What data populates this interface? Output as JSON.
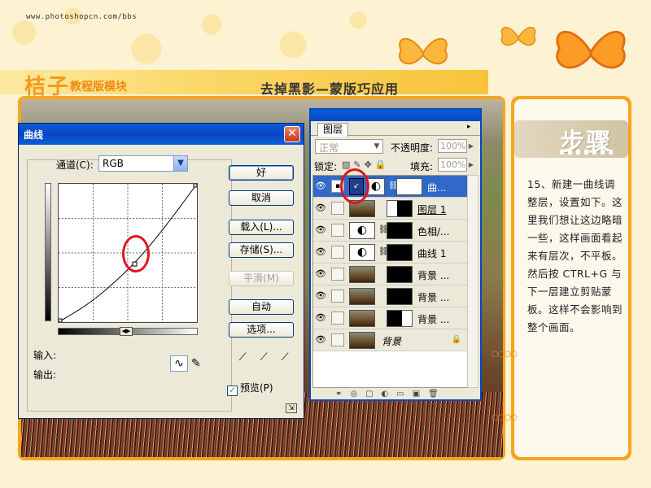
{
  "site_url": "www.photoshopcn.com/bbs",
  "brand": "桔子",
  "brand_sub": "教程版模块",
  "lesson_title": "去掉黑影—蒙版巧应用",
  "colors": {
    "accent": "#f8a420",
    "xp_blue": "#0a5fd8",
    "highlight_red": "#e1141e"
  },
  "curves_dialog": {
    "title": "曲线",
    "channel_label": "通道(C):",
    "channel_value": "RGB",
    "input_label": "输入:",
    "output_label": "输出:",
    "buttons": {
      "ok": "好",
      "cancel": "取消",
      "load": "载入(L)...",
      "save": "存储(S)...",
      "smooth": "平滑(M)",
      "auto": "自动",
      "options": "选项..."
    },
    "preview_label": "预览(P)",
    "preview_checked": true,
    "curve_points": [
      [
        0,
        0
      ],
      [
        0.25,
        0.15
      ],
      [
        0.55,
        0.42
      ],
      [
        0.78,
        0.7
      ],
      [
        1,
        1
      ]
    ],
    "control_point": [
      0.55,
      0.42
    ]
  },
  "layers_panel": {
    "tab": "图层",
    "blend_mode": "正常",
    "opacity_label": "不透明度:",
    "opacity_value": "100%",
    "lock_label": "锁定:",
    "fill_label": "填充:",
    "fill_value": "100%",
    "layers": [
      {
        "name": "曲...",
        "type": "adjustment-curves",
        "active": true
      },
      {
        "name": "图层 1",
        "type": "pixel"
      },
      {
        "name": "色相/...",
        "type": "adjustment-hue"
      },
      {
        "name": "曲线 1",
        "type": "adjustment-curves"
      },
      {
        "name": "背景 ...",
        "type": "pixel-masked"
      },
      {
        "name": "背景 ...",
        "type": "pixel-masked"
      },
      {
        "name": "背景 ...",
        "type": "pixel-masked"
      },
      {
        "name": "背景",
        "type": "background"
      }
    ]
  },
  "step_panel": {
    "title": "步骤",
    "text": "15、新建一曲线调整层，设置如下。这里我们想让这边略暗一些，这样画面看起来有层次，不平板。然后按 CTRL+G 与下一层建立剪贴蒙板。这样不会影响到整个画面。"
  }
}
